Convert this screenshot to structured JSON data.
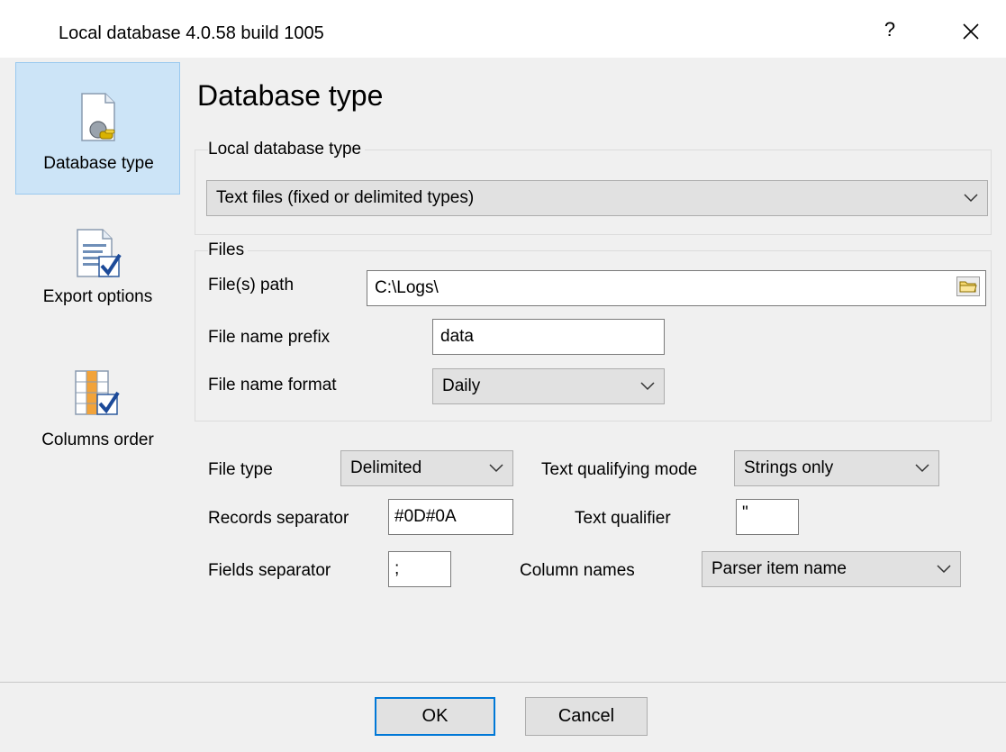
{
  "window": {
    "title": "Local database 4.0.58 build 1005",
    "help_label": "?"
  },
  "nav": {
    "items": [
      {
        "label": "Database type",
        "icon": "plug-document-icon",
        "active": true
      },
      {
        "label": "Export options",
        "icon": "document-checkmark-icon",
        "active": false
      },
      {
        "label": "Columns order",
        "icon": "grid-checkmark-icon",
        "active": false
      }
    ]
  },
  "page": {
    "title": "Database type"
  },
  "local_db_group": {
    "label": "Local database type",
    "selected": "Text files (fixed or delimited types)"
  },
  "files_group": {
    "label": "Files",
    "path_label": "File(s) path",
    "path_value": "C:\\Logs\\",
    "prefix_label": "File name prefix",
    "prefix_value": "data",
    "format_label": "File name format",
    "format_value": "Daily"
  },
  "options": {
    "file_type_label": "File type",
    "file_type_value": "Delimited",
    "qualifying_mode_label": "Text qualifying mode",
    "qualifying_mode_value": "Strings only",
    "records_sep_label": "Records separator",
    "records_sep_value": "#0D#0A",
    "text_qualifier_label": "Text qualifier",
    "text_qualifier_value": "\"",
    "fields_sep_label": "Fields separator",
    "fields_sep_value": ";",
    "column_names_label": "Column names",
    "column_names_value": "Parser item name"
  },
  "footer": {
    "ok_label": "OK",
    "cancel_label": "Cancel"
  },
  "colors": {
    "nav_active_bg": "#cce4f7",
    "default_button_border": "#0078d7",
    "window_bg": "#f0f0f0"
  }
}
